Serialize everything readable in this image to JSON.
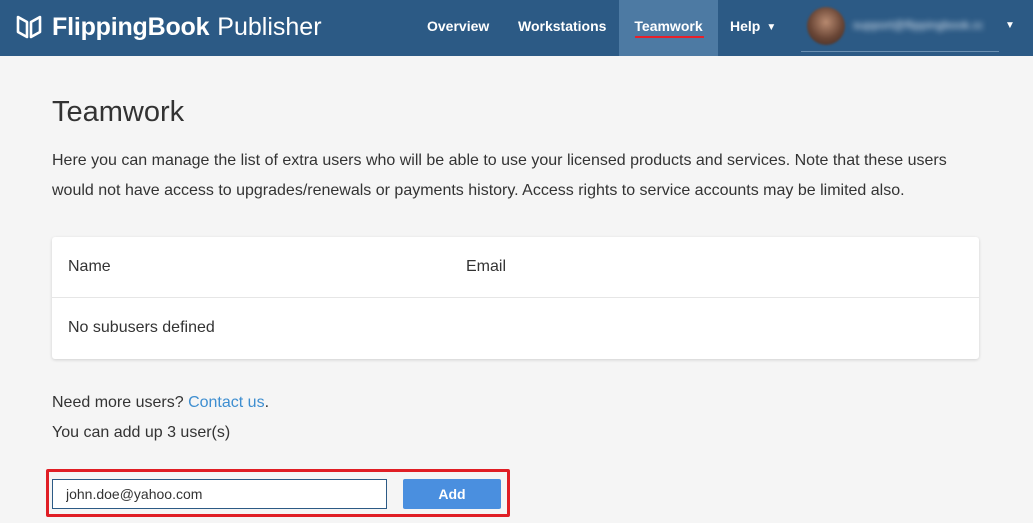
{
  "header": {
    "brand": "FlippingBook",
    "product": "Publisher",
    "nav": {
      "overview": "Overview",
      "workstations": "Workstations",
      "teamwork": "Teamwork",
      "help": "Help"
    },
    "user": {
      "email": "support@flippingbook.com"
    },
    "colors": {
      "bar": "#2c5a85",
      "active_tab": "#4d7aa3",
      "active_underline": "#e8202a"
    }
  },
  "main": {
    "title": "Teamwork",
    "intro": "Here you can manage the list of extra users who will be able to use your licensed products and services. Note that these users would not have access to upgrades/renewals or payments history. Access rights to service accounts may be limited also.",
    "table": {
      "columns": [
        "Name",
        "Email"
      ],
      "empty_text": "No subusers defined"
    },
    "more_users": {
      "prefix": "Need more users?",
      "link": "Contact us",
      "suffix": "."
    },
    "limit_text": "You can add up 3 user(s)",
    "add_form": {
      "email_value": "john.doe@yahoo.com",
      "button": "Add"
    }
  }
}
